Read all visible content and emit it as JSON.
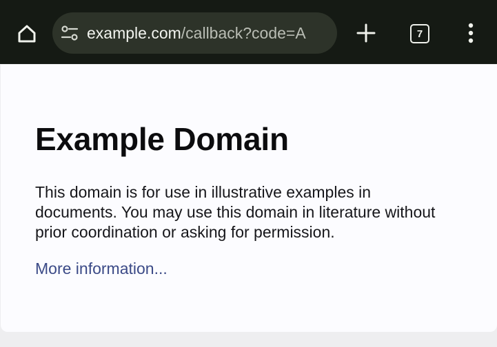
{
  "browser": {
    "url_host": "example.com",
    "url_path": "/callback?code=A",
    "tab_count": "7",
    "icons": {
      "home": "home-icon",
      "site_settings": "tune-icon",
      "new_tab": "plus-icon",
      "tabs": "tab-switcher-icon",
      "menu": "more-vert-icon"
    }
  },
  "page": {
    "heading": "Example Domain",
    "paragraph": "This domain is for use in illustrative examples in documents. You may use this domain in literature without prior coordination or asking for permission.",
    "link_text": "More information..."
  },
  "colors": {
    "toolbar_bg": "#151a14",
    "omnibox_bg": "#2d3329",
    "page_bg": "#fcfcff",
    "link": "#3b4a87"
  }
}
